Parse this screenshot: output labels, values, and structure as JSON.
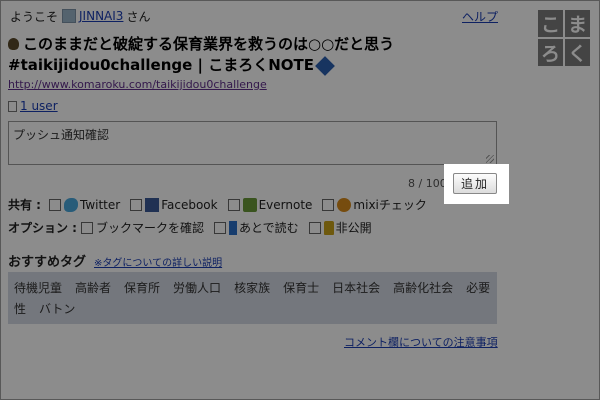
{
  "header": {
    "welcome_prefix": "ようこそ",
    "username": "JINNAI3",
    "welcome_suffix": "さん",
    "help_link": "ヘルプ",
    "logo_chars": [
      "こ",
      "ま",
      "ろ",
      "く"
    ]
  },
  "entry": {
    "title": "このままだと破綻する保育業界を救うのは○○だと思う #taikijidou0challenge | こまろくNOTE",
    "url": "http://www.komaroku.com/taikijidou0challenge",
    "users": "1 user"
  },
  "comment": {
    "value": "プッシュ通知確認",
    "counter": "8 / 100",
    "add_button": "追加"
  },
  "share": {
    "label": "共有 :",
    "options": [
      "Twitter",
      "Facebook",
      "Evernote",
      "mixiチェック"
    ]
  },
  "options": {
    "label": "オプション :",
    "items": [
      "ブックマークを確認",
      "あとで読む",
      "非公開"
    ]
  },
  "recommended": {
    "title": "おすすめタグ",
    "help_link": "※タグについての詳しい説明",
    "tags": [
      "待機児童",
      "高齢者",
      "保育所",
      "労働人口",
      "核家族",
      "保育士",
      "日本社会",
      "高齢化社会",
      "必要性",
      "バトン"
    ]
  },
  "footer": {
    "notice_link": "コメント欄についての注意事項"
  },
  "colors": {
    "link": "#1a3cb3",
    "visited": "#5f2e8a",
    "overlay": "rgba(0,0,0,0.45)",
    "tag_bg": "#d4d9e3"
  }
}
